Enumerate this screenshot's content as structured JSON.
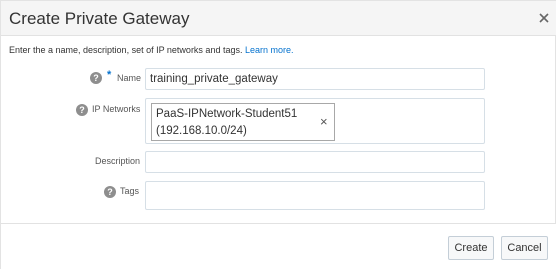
{
  "dialog": {
    "title": "Create Private Gateway",
    "close_icon": "close-icon"
  },
  "intro": {
    "text": "Enter the a name, description, set of IP networks and tags.",
    "link": "Learn more."
  },
  "form": {
    "name": {
      "help_icon": "question-icon",
      "required_marker": "*",
      "label": "Name",
      "value": "training_private_gateway"
    },
    "ip_networks": {
      "help_icon": "question-icon",
      "label": "IP Networks",
      "chip_line1": "PaaS-IPNetwork-Student51",
      "chip_line2": "(192.168.10.0/24)",
      "remove_glyph": "×"
    },
    "description": {
      "label": "Description",
      "value": ""
    },
    "tags": {
      "help_icon": "question-icon",
      "label": "Tags",
      "value": ""
    }
  },
  "footer": {
    "create_label": "Create",
    "cancel_label": "Cancel"
  },
  "colors": {
    "link": "#0572ce",
    "header_bg": "#f5f5f5",
    "field_border": "#d6dfe6"
  }
}
